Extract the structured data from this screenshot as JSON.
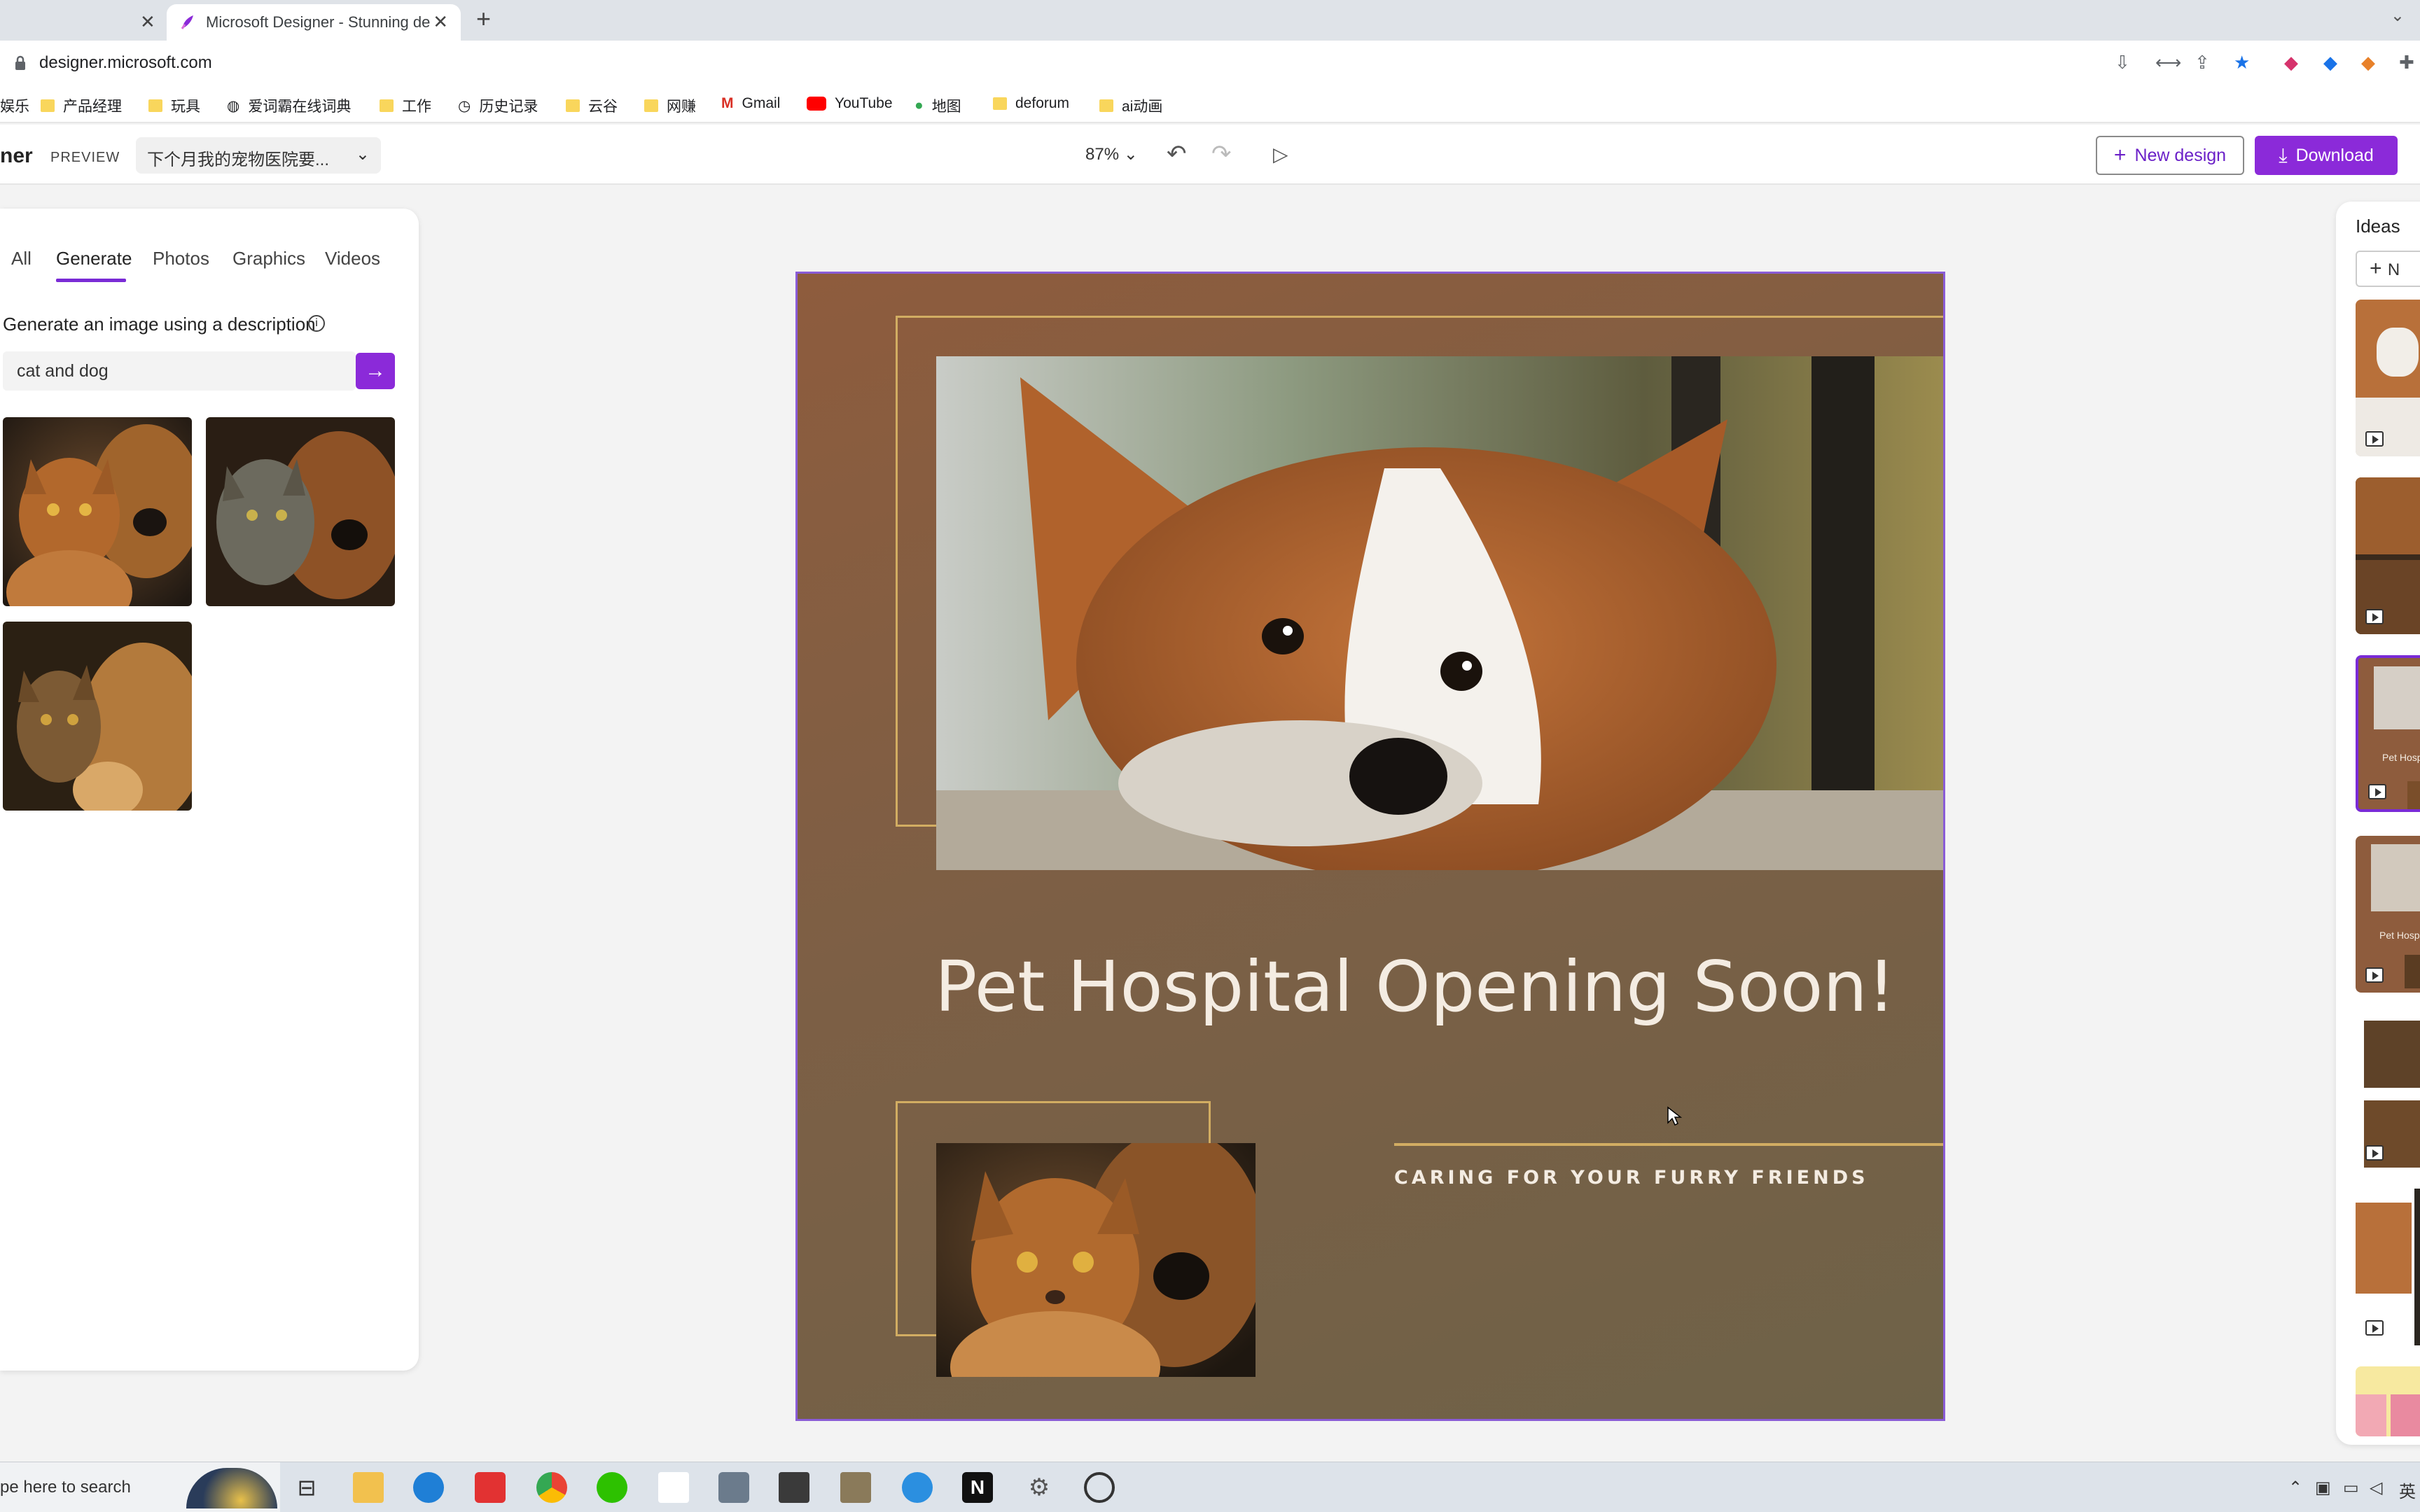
{
  "browser": {
    "active_tab_title": "Microsoft Designer - Stunning designs in a flash",
    "url": "designer.microsoft.com",
    "bookmarks": [
      "娱乐",
      "产品经理",
      "玩具",
      "爱词霸在线词典",
      "工作",
      "历史记录",
      "云谷",
      "网赚",
      "Gmail",
      "YouTube",
      "地图",
      "deforum",
      "ai动画"
    ]
  },
  "app_header": {
    "brand": "ner",
    "preview_badge": "PREVIEW",
    "doc_name": "下个月我的宠物医院要...",
    "zoom": "87%",
    "new_design_label": "New design",
    "download_label": "Download"
  },
  "left_panel": {
    "tabs": [
      "All",
      "Generate",
      "Photos",
      "Graphics",
      "Videos"
    ],
    "active_tab": "Generate",
    "generate_label": "Generate an image using a description",
    "prompt_value": "cat and dog"
  },
  "design": {
    "headline": "Pet Hospital Opening Soon!",
    "tagline": "CARING FOR YOUR FURRY FRIENDS"
  },
  "ideas_panel": {
    "title": "Ideas",
    "new_label": "N",
    "idea_snippet": "Pet Hospi"
  },
  "taskbar": {
    "search_placeholder": "pe here to search",
    "ime": "英"
  },
  "colors": {
    "accent": "#8b2ad9",
    "design_bg": "#8e5c3d",
    "gold": "#d2ad62",
    "headline_text": "#f4ece2"
  }
}
